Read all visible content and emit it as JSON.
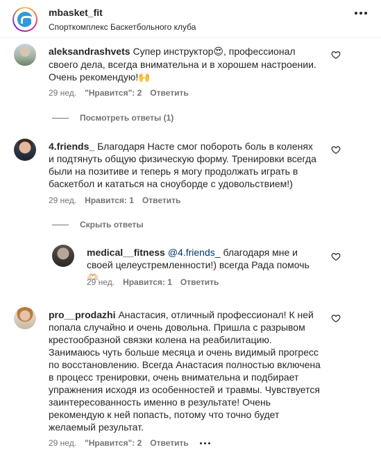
{
  "header": {
    "username": "mbasket_fit",
    "location": "Спорткомплекс Баскетбольного клуба"
  },
  "comments": [
    {
      "username": "aleksandrashvets",
      "text_parts": [
        "Супер инструктор",
        "😍",
        ", профессионал своего дела, всегда внимательна и в хорошем настроении. Очень рекомендую!",
        "🙌"
      ],
      "time": "29 нед.",
      "likes": "\"Нравится\": 2",
      "reply": "Ответить",
      "thread": "Посмотреть ответы (1)"
    },
    {
      "username": "4.friends_",
      "text": "Благодаря Насте смог побороть боль в коленях и подтянуть общую физическую форму. Тренировки всегда были на позитиве и теперь я могу продолжать играть в баскетбол и кататься на сноуборде с удовольствием!)",
      "time": "29 нед.",
      "likes": "Нравится: 1",
      "reply": "Ответить",
      "thread": "Скрыть ответы",
      "replies": [
        {
          "username": "medical__fitness",
          "mention": "@4.friends_",
          "text": "благодаря мне и своей целеустремленности!) всегда Рада помочь",
          "emoji": "🫶🏻",
          "time": "29 нед.",
          "likes": "Нравится: 1",
          "reply": "Ответить"
        }
      ]
    },
    {
      "username": "pro__prodazhi",
      "text": "Анастасия, отличный профессионал! К ней попала случайно и очень довольна. Пришла с разрывом крестообразной связки колена на реабилитацию. Занимаюсь чуть больше месяца и очень видимый прогресс по восстановлению. Всегда Анастасия полностью включена в процесс тренировки, очень внимательна и подбирает упражнения исходя из особенностей и травмы. Чувствуется заинтересованность именно в результате! Очень рекомендую к ней попасть, потому что точно будет желаемый результат.",
      "time": "29 нед.",
      "likes": "\"Нравится\": 2",
      "reply": "Ответить"
    }
  ]
}
